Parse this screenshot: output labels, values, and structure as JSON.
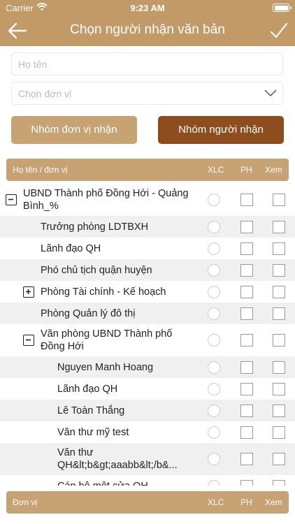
{
  "status_bar": {
    "carrier": "Carrier",
    "time": "9:23 AM"
  },
  "nav": {
    "title": "Chọn người nhận văn bản",
    "back_icon": "arrow-left-icon",
    "done_icon": "checkmark-icon"
  },
  "colors": {
    "header": "#c29a68",
    "button_light": "#c7a272",
    "button_dark": "#8e4d1e",
    "row_alt": "#f0f0f0"
  },
  "search": {
    "name_placeholder": "Họ tên",
    "unit_placeholder": "Chọn đơn vị"
  },
  "tabs": {
    "units_label": "Nhóm đơn vị nhận",
    "people_label": "Nhóm người nhận",
    "active": "people"
  },
  "table_header": {
    "name": "Họ tên / đơn vị",
    "xlc": "XLC",
    "ph": "PH",
    "xem": "Xem"
  },
  "rows": [
    {
      "label": "UBND Thành phố Đồng Hới - Quảng Bình_%",
      "level": 0,
      "expander": "minus"
    },
    {
      "label": "Trưởng phòng LDTBXH",
      "level": 1,
      "expander": "none"
    },
    {
      "label": "Lãnh đạo QH",
      "level": 1,
      "expander": "none"
    },
    {
      "label": "Phó chủ tịch quận huyện",
      "level": 1,
      "expander": "none"
    },
    {
      "label": "Phòng Tài chính - Kế hoạch",
      "level": 1,
      "expander": "plus"
    },
    {
      "label": "Phòng Quản lý đô thị",
      "level": 1,
      "expander": "none"
    },
    {
      "label": "Văn phòng UBND Thành phố Đồng Hới",
      "level": 1,
      "expander": "minus"
    },
    {
      "label": "Nguyen Manh Hoang",
      "level": 2,
      "expander": "none"
    },
    {
      "label": "Lãnh đạo QH",
      "level": 2,
      "expander": "none"
    },
    {
      "label": "Lê Toàn Thắng",
      "level": 2,
      "expander": "none"
    },
    {
      "label": "Văn thư mỹ test",
      "level": 2,
      "expander": "none"
    },
    {
      "label": "Văn thư QH&lt;b&gt;aaabb&lt;/b&...",
      "level": 2,
      "expander": "none"
    },
    {
      "label": "Cán bộ một cửa QH",
      "level": 2,
      "expander": "none"
    }
  ],
  "table_footer": {
    "name": "Đơn vị",
    "xlc": "XLC",
    "ph": "PH",
    "xem": "Xem"
  }
}
